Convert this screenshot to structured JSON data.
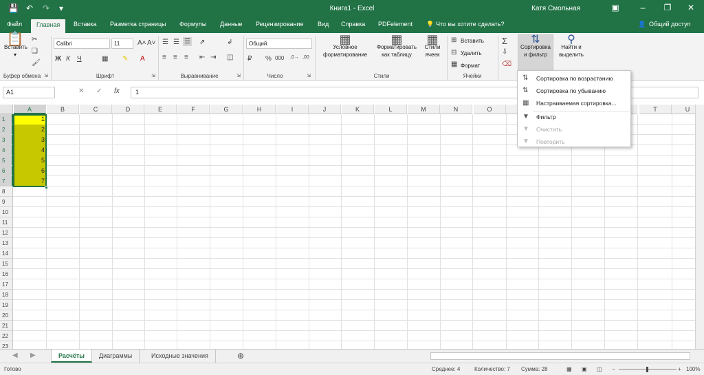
{
  "window": {
    "title": "Книга1  -  Excel",
    "user": "Катя Смольная"
  },
  "tabs": [
    "Файл",
    "Главная",
    "Вставка",
    "Разметка страницы",
    "Формулы",
    "Данные",
    "Рецензирование",
    "Вид",
    "Справка",
    "PDFelement"
  ],
  "search_placeholder": "Что вы хотите сделать?",
  "share_label": "Общий доступ",
  "ribbon": {
    "clipboard": {
      "paste_label": "Вставить",
      "group": "Буфер обмена"
    },
    "font": {
      "font_name": "Calibri",
      "font_size": "11",
      "group": "Шрифт",
      "bold": "Ж",
      "italic": "К",
      "underline": "Ч"
    },
    "alignment": {
      "group": "Выравнивание"
    },
    "number": {
      "format": "Общий",
      "group": "Число"
    },
    "styles": {
      "conditional": "Условное форматирование",
      "table": "Форматировать как таблицу",
      "cell_styles": "Стили ячеек",
      "group": "Стили"
    },
    "cells": {
      "insert": "Вставить",
      "delete": "Удалить",
      "format": "Формат",
      "group": "Ячейки"
    },
    "editing": {
      "sort_filter": "Сортировка и фильтр",
      "find_select": "Найти и выделить"
    }
  },
  "formula_bar": {
    "name_box": "A1",
    "value": "1"
  },
  "columns": [
    "A",
    "B",
    "C",
    "D",
    "E",
    "F",
    "G",
    "H",
    "I",
    "J",
    "K",
    "L",
    "M",
    "N",
    "O",
    "P",
    "Q",
    "R",
    "S",
    "T",
    "U"
  ],
  "rows": [
    "1",
    "2",
    "3",
    "4",
    "5",
    "6",
    "7",
    "8",
    "9",
    "10",
    "11",
    "12",
    "13",
    "14",
    "15",
    "16",
    "17",
    "18",
    "19",
    "20",
    "21",
    "22",
    "23"
  ],
  "cells": [
    "1",
    "2",
    "3",
    "4",
    "5",
    "6",
    "7"
  ],
  "sort_menu": {
    "items": [
      "Сортировка по возрастанию",
      "Сортировка по убыванию",
      "Настраиваемая сортировка...",
      "Фильтр",
      "Очистить",
      "Повторить"
    ]
  },
  "sheets": [
    "Расчёты",
    "Диаграммы",
    "Исходные значения"
  ],
  "status": {
    "ready": "Готово",
    "average": "Среднее: 4",
    "count": "Количество: 7",
    "sum": "Сумма: 28",
    "zoom": "100%"
  },
  "colors": {
    "accent": "#217346",
    "first_cell": "#ffff00",
    "range_fill": "#c8c800"
  }
}
